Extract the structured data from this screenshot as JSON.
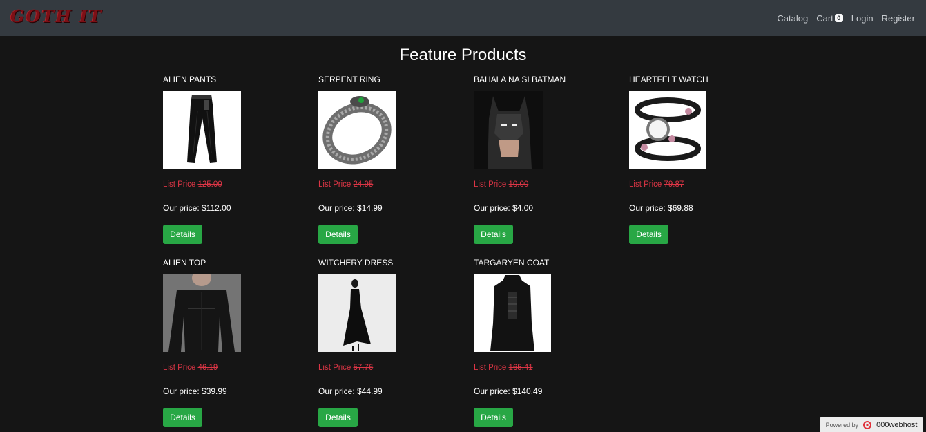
{
  "header": {
    "logo_text": "GOTH IT",
    "nav": {
      "catalog": "Catalog",
      "cart": "Cart",
      "cart_count": "0",
      "login": "Login",
      "register": "Register"
    }
  },
  "main": {
    "title": "Feature Products",
    "list_price_label": "List Price",
    "our_price_label": "Our price:",
    "details_label": "Details",
    "products": [
      {
        "name": "ALIEN PANTS",
        "list_price": "125.00",
        "our_price": "$112.00",
        "image": "pants-image"
      },
      {
        "name": "SERPENT RING",
        "list_price": "24.95",
        "our_price": "$14.99",
        "image": "ring-image"
      },
      {
        "name": "BAHALA NA SI BATMAN",
        "list_price": "10.00",
        "our_price": "$4.00",
        "image": "batman-image"
      },
      {
        "name": "HEARTFELT WATCH",
        "list_price": "79.87",
        "our_price": "$69.88",
        "image": "watch-image"
      },
      {
        "name": "ALIEN TOP",
        "list_price": "46.19",
        "our_price": "$39.99",
        "image": "top-image"
      },
      {
        "name": "WITCHERY DRESS",
        "list_price": "57.76",
        "our_price": "$44.99",
        "image": "dress-image"
      },
      {
        "name": "TARGARYEN COAT",
        "list_price": "165.41",
        "our_price": "$140.49",
        "image": "coat-image"
      }
    ]
  },
  "footer": {
    "powered_by": "Powered by",
    "host": "000webhost"
  },
  "colors": {
    "navbar": "#343a40",
    "background": "#151515",
    "list_price": "#dc3545",
    "button": "#28a745"
  }
}
